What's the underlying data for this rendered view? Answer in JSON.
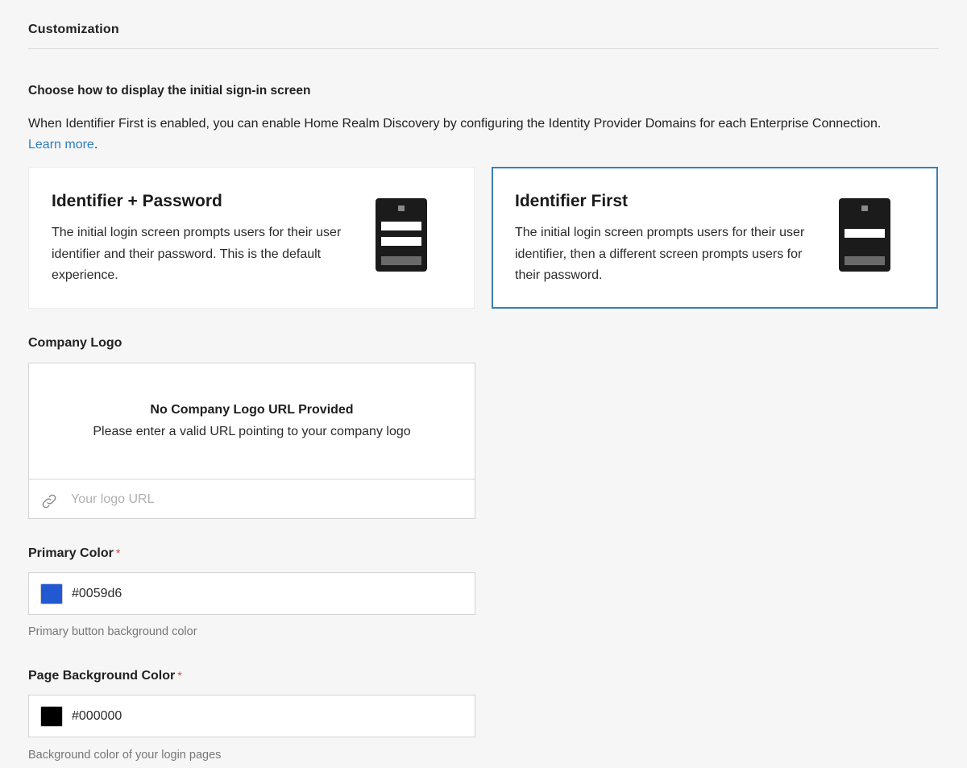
{
  "section": {
    "title": "Customization"
  },
  "signin": {
    "heading": "Choose how to display the initial sign-in screen",
    "description": "When Identifier First is enabled, you can enable Home Realm Discovery by configuring the Identity Provider Domains for each Enterprise Connection.",
    "learn_more": "Learn more",
    "learn_more_suffix": ".",
    "options": [
      {
        "title": "Identifier + Password",
        "text": "The initial login screen prompts users for their user identifier and their password. This is the default experience.",
        "selected": false,
        "illustration_icon": "login-form-two-fields-icon"
      },
      {
        "title": "Identifier First",
        "text": "The initial login screen prompts users for their user identifier, then a different screen prompts users for their password.",
        "selected": true,
        "illustration_icon": "login-form-one-field-icon"
      }
    ]
  },
  "logo": {
    "label": "Company Logo",
    "empty_title": "No Company Logo URL Provided",
    "empty_subtitle": "Please enter a valid URL pointing to your company logo",
    "url_placeholder": "Your logo URL",
    "url_value": "",
    "icon": "link-icon"
  },
  "primary_color": {
    "label": "Primary Color",
    "required_mark": "*",
    "value": "#0059d6",
    "swatch": "#2258d2",
    "help": "Primary button background color"
  },
  "page_background": {
    "label": "Page Background Color",
    "required_mark": "*",
    "value": "#000000",
    "swatch": "#000000",
    "help": "Background color of your login pages"
  },
  "colors": {
    "selected_border": "#3a7fb6",
    "link": "#2d7fbf",
    "required": "#d6453d"
  }
}
